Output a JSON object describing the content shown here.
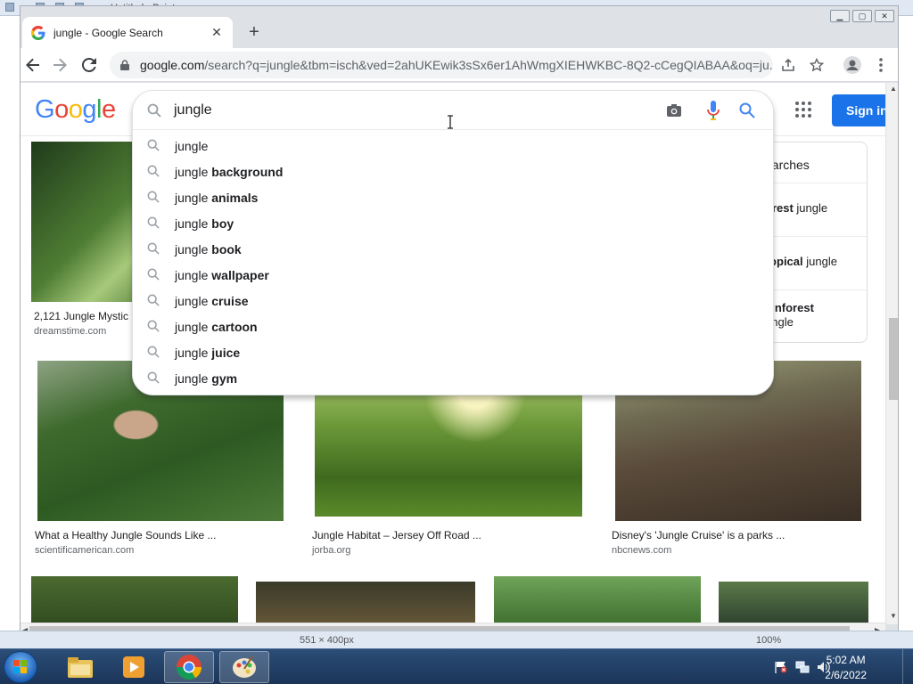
{
  "paint": {
    "title": "Untitled - Paint",
    "status_size": "551 × 400px",
    "status_zoom": "100%"
  },
  "browser": {
    "tab_title": "jungle - Google Search",
    "url_host": "google.com",
    "url_rest": "/search?q=jungle&tbm=isch&ved=2ahUKEwik3sSx6er1AhWmgXIEHWKBC-8Q2-cCegQIABAA&oq=ju..."
  },
  "google": {
    "logo": [
      "G",
      "o",
      "o",
      "g",
      "l",
      "e"
    ],
    "signin_label": "Sign in",
    "search_value": "jungle",
    "suggestions": [
      {
        "prefix": "jungle",
        "bold": ""
      },
      {
        "prefix": "jungle ",
        "bold": "background"
      },
      {
        "prefix": "jungle ",
        "bold": "animals"
      },
      {
        "prefix": "jungle ",
        "bold": "boy"
      },
      {
        "prefix": "jungle ",
        "bold": "book"
      },
      {
        "prefix": "jungle ",
        "bold": "wallpaper"
      },
      {
        "prefix": "jungle ",
        "bold": "cruise"
      },
      {
        "prefix": "jungle ",
        "bold": "cartoon"
      },
      {
        "prefix": "jungle ",
        "bold": "juice"
      },
      {
        "prefix": "jungle ",
        "bold": "gym"
      }
    ]
  },
  "results": {
    "row1": [
      {
        "caption": "2,121 Jungle Mystic",
        "source": "dreamstime.com"
      }
    ],
    "row2": [
      {
        "caption": "What a Healthy Jungle Sounds Like ...",
        "source": "scientificamerican.com"
      },
      {
        "caption": "Jungle Habitat – Jersey Off Road ...",
        "source": "jorba.org"
      },
      {
        "caption": "Disney's 'Jungle Cruise' is a parks ...",
        "source": "nbcnews.com"
      }
    ]
  },
  "related": {
    "heading": "earches",
    "items": [
      {
        "bold": "orest",
        "rest": " jungle"
      },
      {
        "bold": "ropical",
        "rest": " jungle"
      },
      {
        "bold": "ainforest",
        "rest": "ungle"
      }
    ]
  },
  "taskbar": {
    "time": "5:02 AM",
    "date": "2/6/2022"
  },
  "colors": {
    "google_blue": "#4285F4",
    "google_red": "#EA4335",
    "google_yellow": "#FBBC05",
    "google_green": "#34A853",
    "signin_bg": "#1a73e8"
  }
}
